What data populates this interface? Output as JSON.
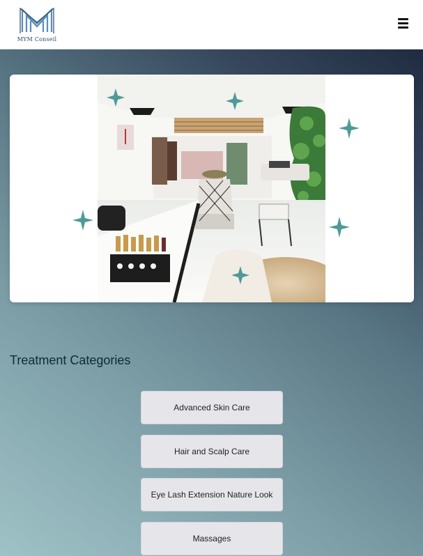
{
  "header": {
    "logo_text": "MYM Conseil",
    "menu_icon": "hamburger-menu-icon"
  },
  "hero": {
    "image_icon": "salon-interior-photo"
  },
  "categories": {
    "title": "Treatment Categories",
    "items": [
      {
        "label": "Advanced Skin Care"
      },
      {
        "label": "Hair and Scalp Care"
      },
      {
        "label": "Eye Lash Extension Nature Look"
      },
      {
        "label": "Massages"
      }
    ]
  },
  "colors": {
    "background_gradient_start": "#9fc2c6",
    "background_gradient_end": "#1f2b40",
    "button_bg": "#e6e6ea",
    "title_color": "#0f2a36",
    "sparkle": "#4e9a96"
  }
}
